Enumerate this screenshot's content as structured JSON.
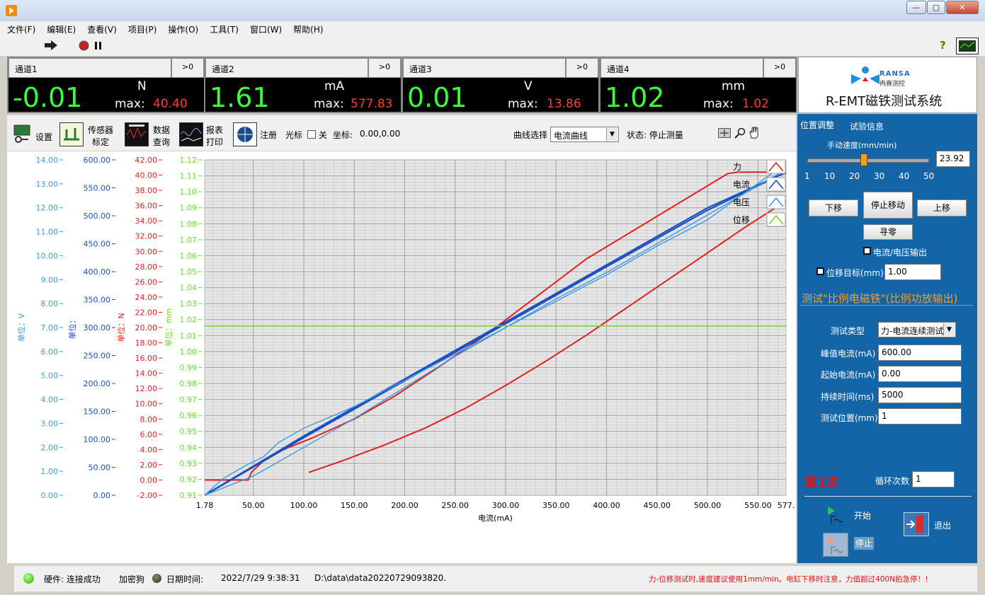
{
  "menu": [
    "文件(F)",
    "编辑(E)",
    "查看(V)",
    "项目(P)",
    "操作(O)",
    "工具(T)",
    "窗口(W)",
    "帮助(H)"
  ],
  "window_buttons": {
    "minimize": "—",
    "maximize": "▢",
    "close": "✕"
  },
  "help_icon": "?",
  "channels": [
    {
      "name": "通道1",
      "gt": ">0",
      "value": "-0.01",
      "unit": "N",
      "max_label": "max:",
      "max": "40.40"
    },
    {
      "name": "通道2",
      "gt": ">0",
      "value": "1.61",
      "unit": "mA",
      "max_label": "max:",
      "max": "577.83"
    },
    {
      "name": "通道3",
      "gt": ">0",
      "value": "0.01",
      "unit": "V",
      "max_label": "max:",
      "max": "13.86"
    },
    {
      "name": "通道4",
      "gt": ">0",
      "value": "1.02",
      "unit": "mm",
      "max_label": "max:",
      "max": "1.02"
    }
  ],
  "logo": {
    "brand": "RANSA",
    "brand_cn": "冉赛测控",
    "title": "R-EMT磁铁测试系统"
  },
  "tools": {
    "settings": "设置",
    "sensor_1": "传感器",
    "sensor_2": "标定",
    "data_1": "数据",
    "data_2": "查询",
    "report_1": "报表",
    "report_2": "打印",
    "register": "注册",
    "cursor": "光标",
    "cursor_state": "关",
    "coord_label": "坐标:",
    "coord_value": "0.00,0.00",
    "curve_select_label": "曲线选择",
    "curve_select_value": "电流曲线",
    "state": "状态: 停止测量"
  },
  "right_panel": {
    "tab_position": "位置调整",
    "tab_info": "试验信息",
    "speed_label": "手动速度(mm/min)",
    "speed_value": "23.92",
    "speed_level": 23.92,
    "speed_ticks": [
      "1",
      "10",
      "20",
      "30",
      "40",
      "50"
    ],
    "down": "下移",
    "stop_move": "停止移动",
    "up": "上移",
    "zero": "寻零",
    "cv_output": "电流/电压输出",
    "target_label": "位移目标(mm)",
    "target_value": "1.00",
    "test_title": "测试\"比例电磁铁\"(比例功放输出)",
    "test_type_label": "测试类型",
    "test_type_value": "力-电流连续测试",
    "peak_label": "峰值电流(mA)",
    "peak_value": "600.00",
    "start_label": "起始电流(mA)",
    "start_value": "0.00",
    "duration_label": "持续时间(ms)",
    "duration_value": "5000",
    "position_label": "测试位置(mm)",
    "position_value": "1",
    "count_text": "第1次",
    "cycles_label": "循环次数",
    "cycles_value": "1",
    "start_btn": "开始",
    "stop_btn": "停止",
    "exit_btn": "退出"
  },
  "status": {
    "hardware": "硬件: 连接成功",
    "dongle": "加密狗",
    "datetime_label": "日期时间:",
    "datetime": "2022/7/29 9:38:31",
    "path": "D:\\data\\data20220729093820.",
    "warning": "力-位移测试时,速度建议使用1mm/min。电缸下移时注意，力值超过400N拍急停！！"
  },
  "colors": {
    "force": "#e02020",
    "current": "#1a4fc4",
    "voltage": "#3c9ae0",
    "displacement": "#66dd22"
  },
  "chart_data": {
    "type": "line",
    "xlabel": "电流(mA)",
    "x_ticks": [
      "1.78",
      "50.00",
      "100.00",
      "150.00",
      "200.00",
      "250.00",
      "300.00",
      "350.00",
      "400.00",
      "450.00",
      "500.00",
      "550.00",
      "577."
    ],
    "xlim": [
      1.78,
      577.83
    ],
    "axes": {
      "voltage": {
        "label": "单位：V",
        "ticks": [
          "0.00",
          "1.00",
          "2.00",
          "3.00",
          "4.00",
          "5.00",
          "6.00",
          "7.00",
          "8.00",
          "9.00",
          "10.00",
          "11.00",
          "12.00",
          "13.00",
          "14.00"
        ],
        "range": [
          0,
          14
        ]
      },
      "current": {
        "label": "单位：",
        "ticks": [
          "0.00",
          "50.00",
          "100.00",
          "150.00",
          "200.00",
          "250.00",
          "300.00",
          "350.00",
          "400.00",
          "450.00",
          "500.00",
          "550.00",
          "600.00"
        ],
        "range": [
          0,
          600
        ]
      },
      "force": {
        "label": "单位：N",
        "ticks": [
          "-2.00",
          "0.00",
          "2.00",
          "4.00",
          "6.00",
          "8.00",
          "10.00",
          "12.00",
          "14.00",
          "16.00",
          "18.00",
          "20.00",
          "22.00",
          "24.00",
          "26.00",
          "28.00",
          "30.00",
          "32.00",
          "34.00",
          "36.00",
          "38.00",
          "40.00",
          "42.00"
        ],
        "range": [
          -2,
          42
        ]
      },
      "displacement": {
        "label": "单位：mm",
        "ticks": [
          "0.91",
          "0.92",
          "0.93",
          "0.94",
          "0.95",
          "0.96",
          "0.97",
          "0.98",
          "0.99",
          "1.00",
          "1.01",
          "1.02",
          "1.03",
          "1.04",
          "1.05",
          "1.06",
          "1.07",
          "1.08",
          "1.09",
          "1.10",
          "1.11",
          "1.12"
        ],
        "range": [
          0.91,
          1.12
        ]
      }
    },
    "legend": [
      "力",
      "电流",
      "电压",
      "位移"
    ],
    "series": [
      {
        "name": "力",
        "axis": "force",
        "x": [
          1.78,
          42,
          45,
          48,
          60,
          80,
          110,
          150,
          190,
          230,
          280,
          330,
          380,
          430,
          480,
          520,
          530,
          560,
          577.8
        ],
        "y": [
          0,
          0,
          0,
          1,
          2.5,
          4,
          5.6,
          8,
          11,
          14.5,
          19,
          24,
          29,
          33,
          37,
          40.2,
          40.4,
          40.4,
          40.2
        ]
      },
      {
        "name": "力",
        "axis": "force",
        "x": [
          105,
          140,
          180,
          220,
          260,
          300,
          340,
          380,
          420,
          460,
          500,
          540,
          577.8
        ],
        "y": [
          1,
          2.6,
          4.6,
          6.8,
          9.4,
          12.4,
          15.6,
          19,
          22.6,
          26.2,
          29.8,
          33.4,
          36.6
        ]
      },
      {
        "name": "电流",
        "axis": "current",
        "x": [
          1.78,
          100,
          200,
          300,
          400,
          500,
          577.8
        ],
        "y": [
          0,
          103,
          205,
          307,
          409,
          510,
          578
        ]
      },
      {
        "name": "电流",
        "axis": "current",
        "x": [
          1.78,
          100,
          200,
          300,
          400,
          500,
          577.8
        ],
        "y": [
          0,
          106,
          208,
          310,
          412,
          514,
          578
        ]
      },
      {
        "name": "电压",
        "axis": "voltage",
        "x": [
          1.78,
          20,
          45,
          60,
          75,
          100,
          150,
          200,
          250,
          300,
          350,
          400,
          450,
          500,
          577.8
        ],
        "y": [
          0,
          0.7,
          1.3,
          1.6,
          2.2,
          2.8,
          3.7,
          4.8,
          5.9,
          7,
          8.1,
          9.2,
          10.4,
          11.5,
          13.86
        ]
      },
      {
        "name": "电压",
        "axis": "voltage",
        "x": [
          1.78,
          50,
          100,
          150,
          200,
          250,
          300,
          350,
          400,
          450,
          500,
          577.8
        ],
        "y": [
          0,
          0.8,
          2.0,
          3.2,
          4.5,
          5.8,
          7.0,
          8.2,
          9.3,
          10.5,
          11.7,
          13.6
        ]
      },
      {
        "name": "位移",
        "axis": "displacement",
        "x": [
          1.78,
          577.8
        ],
        "y": [
          1.016,
          1.016
        ]
      }
    ]
  }
}
